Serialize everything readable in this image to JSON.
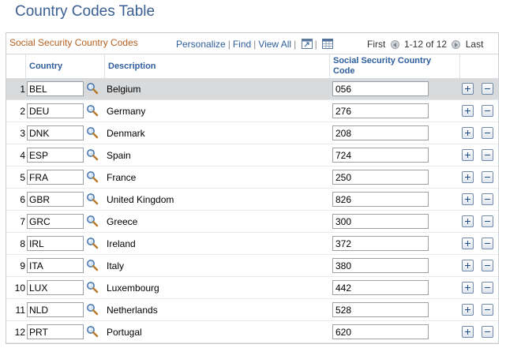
{
  "page": {
    "title": "Country Codes Table"
  },
  "grid": {
    "title": "Social Security Country Codes",
    "links": {
      "personalize": "Personalize",
      "find": "Find",
      "view_all": "View All"
    },
    "pager": {
      "first": "First",
      "range": "1-12 of 12",
      "last": "Last"
    },
    "columns": {
      "country": "Country",
      "description": "Description",
      "ss_code_line1": "Social Security Country",
      "ss_code_line2": "Code"
    },
    "rows": [
      {
        "num": "1",
        "country": "BEL",
        "description": "Belgium",
        "code": "056"
      },
      {
        "num": "2",
        "country": "DEU",
        "description": "Germany",
        "code": "276"
      },
      {
        "num": "3",
        "country": "DNK",
        "description": "Denmark",
        "code": "208"
      },
      {
        "num": "4",
        "country": "ESP",
        "description": "Spain",
        "code": "724"
      },
      {
        "num": "5",
        "country": "FRA",
        "description": "France",
        "code": "250"
      },
      {
        "num": "6",
        "country": "GBR",
        "description": "United Kingdom",
        "code": "826"
      },
      {
        "num": "7",
        "country": "GRC",
        "description": "Greece",
        "code": "300"
      },
      {
        "num": "8",
        "country": "IRL",
        "description": "Ireland",
        "code": "372"
      },
      {
        "num": "9",
        "country": "ITA",
        "description": "Italy",
        "code": "380"
      },
      {
        "num": "10",
        "country": "LUX",
        "description": "Luxembourg",
        "code": "442"
      },
      {
        "num": "11",
        "country": "NLD",
        "description": "Netherlands",
        "code": "528"
      },
      {
        "num": "12",
        "country": "PRT",
        "description": "Portugal",
        "code": "620"
      }
    ],
    "icons": {
      "lookup": "magnifier-lookup-icon",
      "zoom": "zoom-grid-icon",
      "download": "spreadsheet-download-icon",
      "add_row": "plus-icon",
      "delete_row": "minus-icon"
    }
  },
  "colors": {
    "title": "#3b5f92",
    "grid_title": "#b55f20",
    "link": "#2e5e9d",
    "active_row": "#d9dadc"
  }
}
